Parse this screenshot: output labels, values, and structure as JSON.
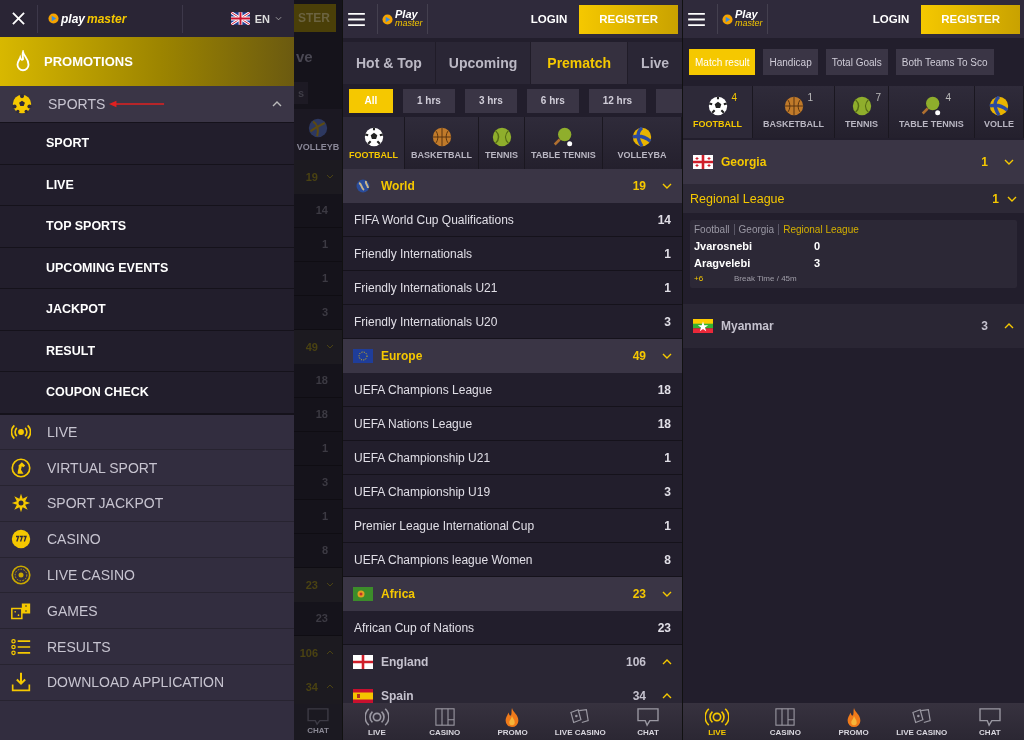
{
  "drawer": {
    "logo": {
      "top": "play",
      "bottom": "master"
    },
    "language": "EN",
    "promotions": "PROMOTIONS",
    "sports": {
      "label": "SPORTS",
      "expanded": true,
      "children": [
        "SPORT",
        "LIVE",
        "TOP SPORTS",
        "UPCOMING EVENTS",
        "JACKPOT",
        "RESULT",
        "COUPON CHECK"
      ]
    },
    "items": [
      {
        "label": "LIVE",
        "kind": "live"
      },
      {
        "label": "VIRTUAL SPORT",
        "kind": "virtual"
      },
      {
        "label": "SPORT JACKPOT",
        "kind": "jackpot"
      },
      {
        "label": "CASINO",
        "kind": "casino"
      },
      {
        "label": "LIVE CASINO",
        "kind": "roulette"
      },
      {
        "label": "GAMES",
        "kind": "games"
      },
      {
        "label": "RESULTS",
        "kind": "results"
      },
      {
        "label": "DOWNLOAD APPLICATION",
        "kind": "download"
      }
    ]
  },
  "background_strip": {
    "register": "STER",
    "tab": "ve",
    "filter": "s",
    "sport": "VOLLEYB",
    "nav": "CHAT",
    "rows": [
      {
        "kind": "group",
        "count": "19",
        "expanded": true
      },
      {
        "kind": "row",
        "count": "14"
      },
      {
        "kind": "row",
        "count": "1"
      },
      {
        "kind": "row",
        "count": "1"
      },
      {
        "kind": "row",
        "count": "3"
      },
      {
        "kind": "group",
        "count": "49",
        "expanded": true
      },
      {
        "kind": "row",
        "count": "18"
      },
      {
        "kind": "row",
        "count": "18"
      },
      {
        "kind": "row",
        "count": "1"
      },
      {
        "kind": "row",
        "count": "3"
      },
      {
        "kind": "row",
        "count": "1"
      },
      {
        "kind": "row",
        "count": "8"
      },
      {
        "kind": "group",
        "count": "23",
        "expanded": true
      },
      {
        "kind": "row",
        "count": "23"
      },
      {
        "kind": "group",
        "count": "106",
        "expanded": false
      },
      {
        "kind": "group",
        "count": "34",
        "expanded": false
      }
    ]
  },
  "prematch_screen": {
    "logo": {
      "top": "Play",
      "bottom": "master"
    },
    "login": "LOGIN",
    "register": "REGISTER",
    "tabs": [
      {
        "label": "Hot & Top",
        "selected": false
      },
      {
        "label": "Upcoming",
        "selected": false
      },
      {
        "label": "Prematch",
        "selected": true
      },
      {
        "label": "Live",
        "selected": false
      }
    ],
    "filters": [
      {
        "label": "All",
        "selected": true
      },
      {
        "label": "1 hrs",
        "selected": false
      },
      {
        "label": "3 hrs",
        "selected": false
      },
      {
        "label": "6 hrs",
        "selected": false
      },
      {
        "label": "12 hrs",
        "selected": false
      }
    ],
    "sports": [
      {
        "label": "FOOTBALL",
        "kind": "football",
        "selected": true
      },
      {
        "label": "BASKETBALL",
        "kind": "basketball",
        "selected": false
      },
      {
        "label": "TENNIS",
        "kind": "tennis",
        "selected": false
      },
      {
        "label": "TABLE TENNIS",
        "kind": "table-tennis",
        "selected": false
      },
      {
        "label": "VOLLEYBA",
        "kind": "volleyball",
        "selected": false
      }
    ],
    "groups": [
      {
        "name": "World",
        "kind": "globe",
        "count": "19",
        "expanded": true,
        "leagues": [
          {
            "name": "FIFA World Cup Qualifications",
            "count": "14"
          },
          {
            "name": "Friendly Internationals",
            "count": "1"
          },
          {
            "name": "Friendly Internationals U21",
            "count": "1"
          },
          {
            "name": "Friendly Internationals U20",
            "count": "3"
          }
        ]
      },
      {
        "name": "Europe",
        "kind": "eu",
        "count": "49",
        "expanded": true,
        "leagues": [
          {
            "name": "UEFA Champions League",
            "count": "18"
          },
          {
            "name": "UEFA Nations League",
            "count": "18"
          },
          {
            "name": "UEFA Championship U21",
            "count": "1"
          },
          {
            "name": "UEFA Championship U19",
            "count": "3"
          },
          {
            "name": "Premier League International Cup",
            "count": "1"
          },
          {
            "name": "UEFA Champions league Women",
            "count": "8"
          }
        ]
      },
      {
        "name": "Africa",
        "kind": "africa",
        "count": "23",
        "expanded": true,
        "leagues": [
          {
            "name": "African Cup of Nations",
            "count": "23"
          }
        ]
      },
      {
        "name": "England",
        "kind": "england",
        "count": "106",
        "expanded": false
      },
      {
        "name": "Spain",
        "kind": "spain",
        "count": "34",
        "expanded": false
      }
    ],
    "nav": [
      {
        "label": "LIVE",
        "kind": "live",
        "selected": false
      },
      {
        "label": "CASINO",
        "kind": "casino",
        "selected": false
      },
      {
        "label": "PROMO",
        "kind": "promo",
        "selected": false
      },
      {
        "label": "LIVE CASINO",
        "kind": "live-casino",
        "selected": false
      },
      {
        "label": "CHAT",
        "kind": "chat",
        "selected": false
      }
    ]
  },
  "live_screen": {
    "logo": {
      "top": "Play",
      "bottom": "master"
    },
    "login": "LOGIN",
    "register": "REGISTER",
    "markets": [
      {
        "label": "Match result",
        "selected": true
      },
      {
        "label": "Handicap",
        "selected": false
      },
      {
        "label": "Total Goals",
        "selected": false
      },
      {
        "label": "Both Teams To Sco",
        "selected": false
      }
    ],
    "sports": [
      {
        "label": "FOOTBALL",
        "kind": "football",
        "count": "4",
        "selected": true
      },
      {
        "label": "BASKETBALL",
        "kind": "basketball",
        "count": "1",
        "selected": false
      },
      {
        "label": "TENNIS",
        "kind": "tennis",
        "count": "7",
        "selected": false
      },
      {
        "label": "TABLE TENNIS",
        "kind": "table-tennis",
        "count": "4",
        "selected": false
      },
      {
        "label": "VOLLE",
        "kind": "volleyball",
        "selected": false
      }
    ],
    "groups": [
      {
        "name": "Georgia",
        "kind": "georgia",
        "count": "1",
        "expanded": true,
        "leagues": [
          {
            "name": "Regional League",
            "count": "1",
            "expanded": true,
            "matches": [
              {
                "sport": "Football",
                "country": "Georgia",
                "league": "Regional League",
                "home": "Jvarosnebi",
                "home_score": "0",
                "away": "Aragvelebi",
                "away_score": "3",
                "more": "+6",
                "status": "Break Time / 45m"
              }
            ]
          }
        ]
      },
      {
        "name": "Myanmar",
        "kind": "myanmar",
        "count": "3",
        "expanded": false
      }
    ],
    "nav": [
      {
        "label": "LIVE",
        "kind": "live",
        "selected": true
      },
      {
        "label": "CASINO",
        "kind": "casino",
        "selected": false
      },
      {
        "label": "PROMO",
        "kind": "promo",
        "selected": false
      },
      {
        "label": "LIVE CASINO",
        "kind": "live-casino",
        "selected": false
      },
      {
        "label": "CHAT",
        "kind": "chat",
        "selected": false
      }
    ]
  }
}
